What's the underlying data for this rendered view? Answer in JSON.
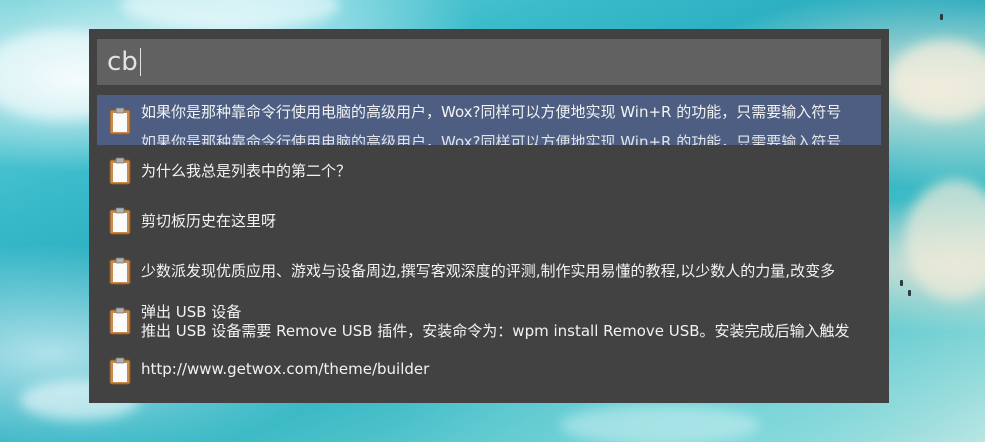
{
  "query": {
    "value": "cb"
  },
  "results": [
    {
      "title": "如果你是那种靠命令行使用电脑的高级用户，Wox?同样可以方便地实现 Win+R 的功能，只需要输入符号",
      "subtitle": "",
      "selected": true,
      "icon": "clipboard-icon"
    },
    {
      "title": "为什么我总是列表中的第二个？",
      "subtitle": "",
      "selected": false,
      "icon": "clipboard-icon"
    },
    {
      "title": "剪切板历史在这里呀",
      "subtitle": "",
      "selected": false,
      "icon": "clipboard-icon"
    },
    {
      "title": "少数派发现优质应用、游戏与设备周边,撰写客观深度的评测,制作实用易懂的教程,以少数人的力量,改变多",
      "subtitle": "",
      "selected": false,
      "icon": "clipboard-icon"
    },
    {
      "title": "弹出 USB 设备",
      "subtitle": "推出 USB 设备需要 Remove USB 插件，安装命令为：wpm install Remove USB。安装完成后输入触发",
      "selected": false,
      "icon": "clipboard-icon"
    },
    {
      "title": "http://www.getwox.com/theme/builder",
      "subtitle": "",
      "selected": false,
      "icon": "clipboard-icon"
    }
  ],
  "colors": {
    "window_bg": "#424242",
    "query_bg": "#616161",
    "selected_bg": "#4d5e82",
    "text": "#f2f2f2"
  }
}
